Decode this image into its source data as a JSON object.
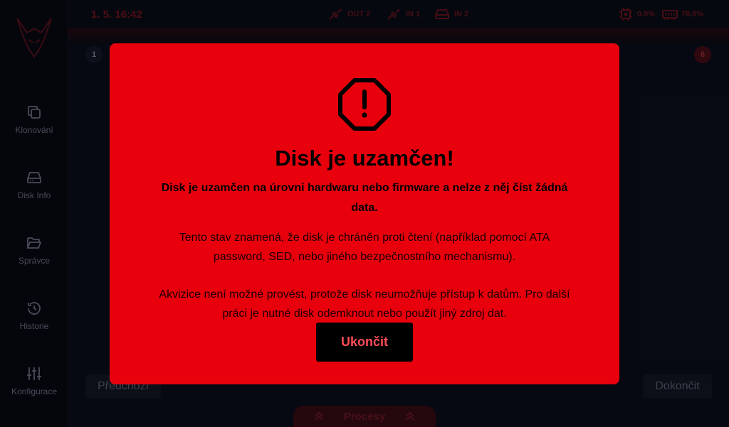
{
  "sidebar": {
    "items": [
      {
        "label": "Klonování",
        "icon": "copy-icon"
      },
      {
        "label": "Disk Info",
        "icon": "hard-drive-icon"
      },
      {
        "label": "Správce",
        "icon": "folder-open-icon"
      },
      {
        "label": "Historie",
        "icon": "history-icon"
      },
      {
        "label": "Konfigurace",
        "icon": "sliders-icon"
      }
    ]
  },
  "topbar": {
    "datetime": "1. 5. 16:42",
    "ports": [
      {
        "label": "OUT 2",
        "icon": "cable-icon"
      },
      {
        "label": "IN 1",
        "icon": "cable-icon"
      },
      {
        "label": "IN 2",
        "icon": "drive-icon"
      }
    ],
    "cpu": {
      "value": "0.9%",
      "icon": "cpu-icon"
    },
    "ram": {
      "value": "78.8%",
      "icon": "memory-icon"
    }
  },
  "steps": {
    "first": "1",
    "last": "6"
  },
  "footer": {
    "prev_label": "Předchozí",
    "done_label": "Dokončit",
    "procesy_label": "Procesy"
  },
  "modal": {
    "icon": "warning-octagon-icon",
    "title": "Disk je uzamčen!",
    "subtitle": "Disk je uzamčen na úrovni hardwaru nebo firmware a nelze z něj číst žádná data.",
    "body1": "Tento stav znamená, že disk je chráněn proti čtení (například pomocí ATA password, SED, nebo jiného bezpečnostního mechanismu).",
    "body2": "Akvizice není možné provést, protože disk neumožňuje přístup k datům. Pro další práci je nutné disk odemknout nebo použít jiný zdroj dat.",
    "button_label": "Ukončit"
  },
  "colors": {
    "accent": "#e8000d",
    "background": "#0a0d18",
    "button_text": "#ff4d57"
  }
}
